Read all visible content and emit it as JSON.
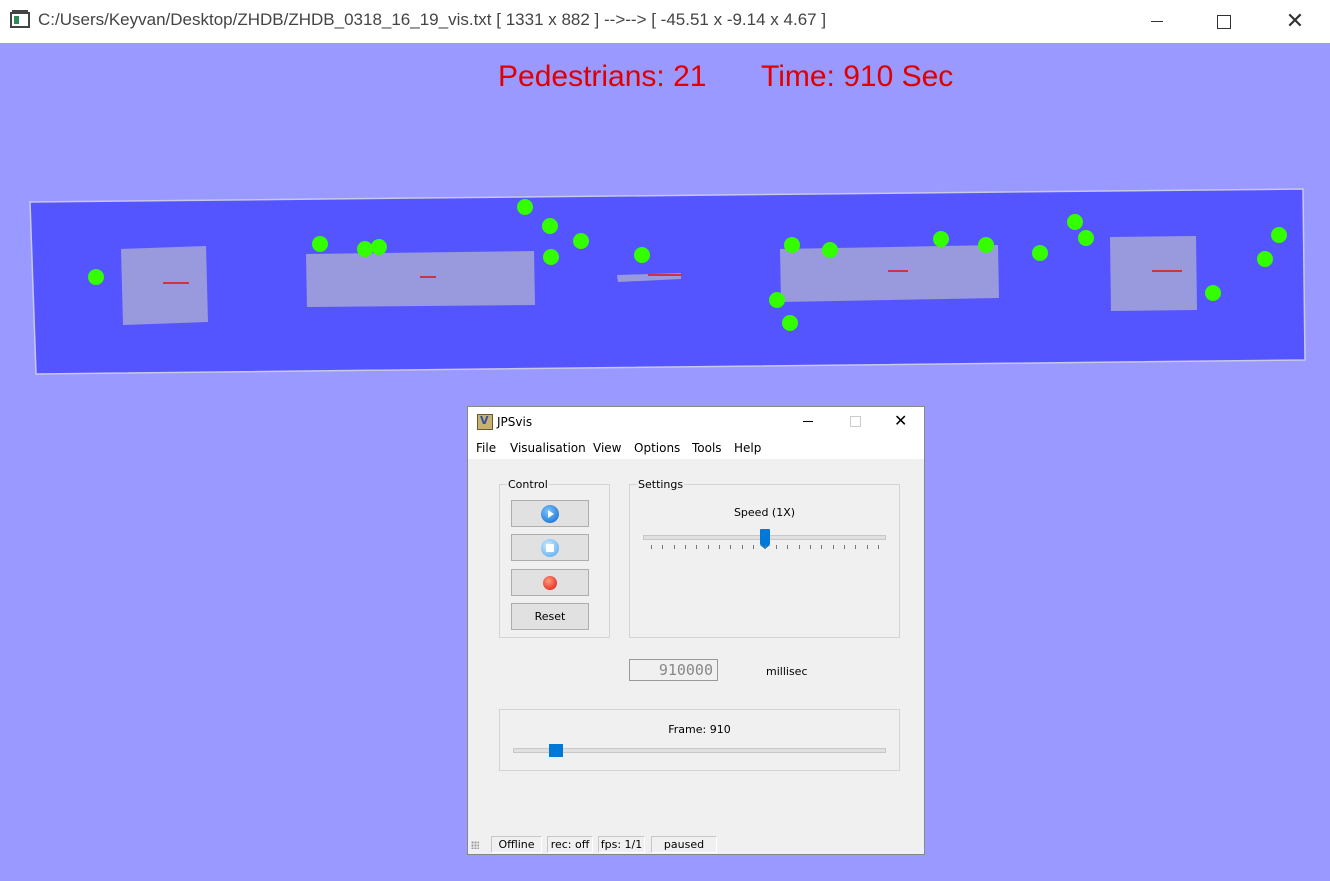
{
  "window": {
    "title": "C:/Users/Keyvan/Desktop/ZHDB/ZHDB_0318_16_19_vis.txt [ 1331 x 882 ] -->--> [ -45.51 x -9.14 x 4.67 ]",
    "close_glyph": "✕"
  },
  "hud": {
    "pedestrians": "Pedestrians: 21",
    "time": "Time: 910 Sec",
    "color": "#e00000"
  },
  "scene": {
    "background": "#9999ff",
    "floor_color": "#5555ff",
    "obstacle_color": "#9999dd",
    "pedestrian_color": "#33ff00",
    "obstacle_count": 5,
    "pedestrian_count": 21
  },
  "dialog": {
    "title": "JPSvis",
    "close_glyph": "✕",
    "menu": [
      "File",
      "Visualisation",
      "View",
      "Options",
      "Tools",
      "Help"
    ],
    "control": {
      "title": "Control",
      "buttons": [
        "play-icon",
        "stop-icon",
        "record-icon"
      ],
      "reset_label": "Reset"
    },
    "settings": {
      "title": "Settings",
      "speed_label": "Speed (1X)",
      "speed_value_fraction": 0.5
    },
    "lcd_value": "910000",
    "ms_label": "millisec",
    "frame": {
      "label": "Frame: 910",
      "slider_fraction": 0.1
    },
    "status": [
      "Offline",
      "rec: off",
      "fps: 1/1",
      "paused"
    ],
    "accent": "#0078d7"
  }
}
